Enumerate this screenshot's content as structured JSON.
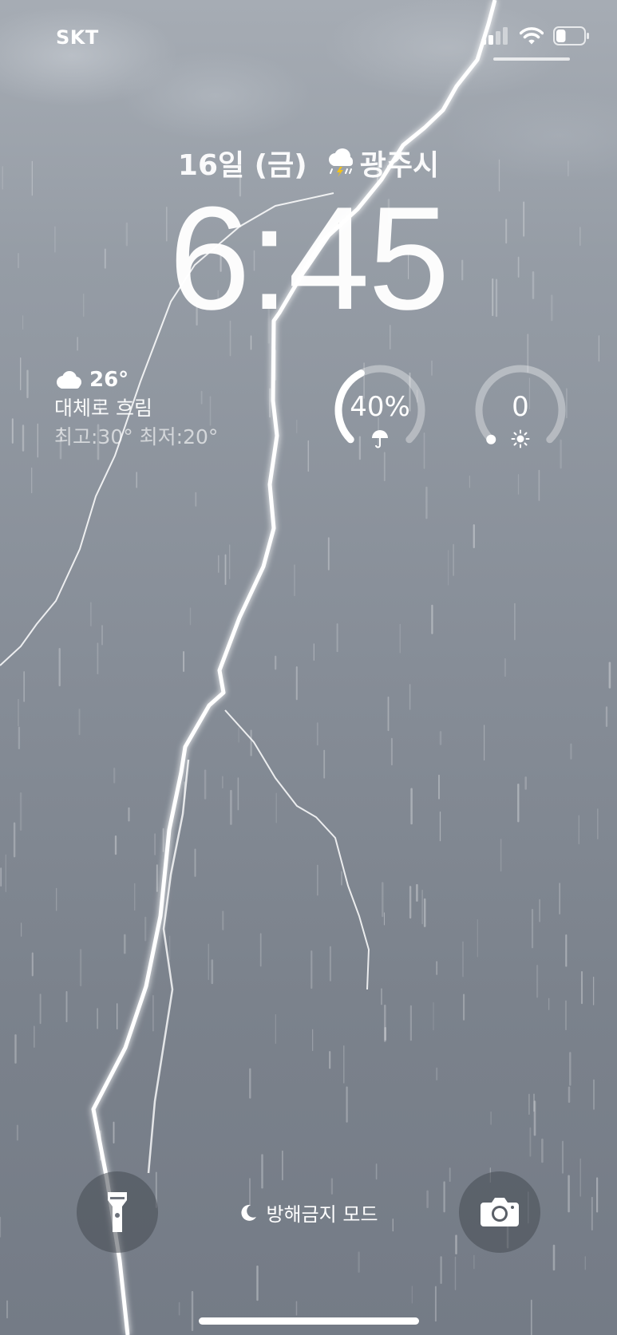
{
  "status_bar": {
    "carrier": "SKT",
    "signal_icon": "cellular-signal-icon",
    "wifi_icon": "wifi-icon",
    "battery_icon": "battery-icon",
    "battery_level": 0.35
  },
  "lock": {
    "date": "16일 (금)",
    "weather_icon": "thunderstorm-icon",
    "location": "광주시",
    "time": "6:45"
  },
  "weather_widget": {
    "icon": "cloud-icon",
    "temperature": "26°",
    "condition": "대체로 흐림",
    "high_low": "최고:30° 최저:20°"
  },
  "rain_widget": {
    "value": "40%",
    "icon": "umbrella-icon",
    "fraction": 0.4
  },
  "uv_widget": {
    "value": "0",
    "icon": "sun-icon",
    "fraction": 0.0
  },
  "bottom": {
    "flashlight_icon": "flashlight-icon",
    "focus_icon": "moon-icon",
    "focus_label": "방해금지 모드",
    "camera_icon": "camera-icon"
  },
  "colors": {
    "sky_top": "#a6acb4",
    "sky_bottom": "#747b86",
    "text": "#ffffff",
    "button_bg": "#464a52"
  }
}
